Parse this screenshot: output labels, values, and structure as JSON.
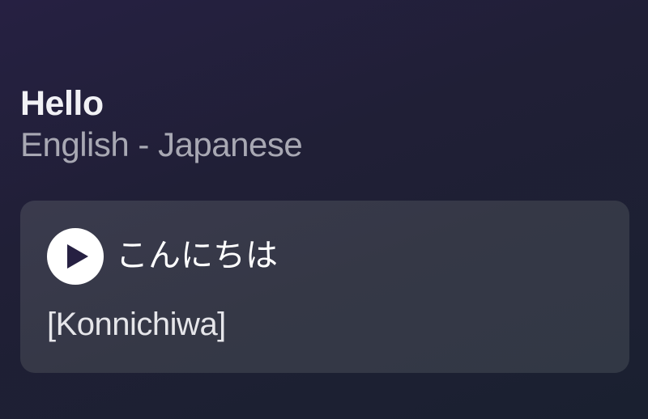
{
  "header": {
    "word": "Hello",
    "language_pair": "English - Japanese"
  },
  "card": {
    "play_icon": "play-icon",
    "translation": "こんにちは",
    "romanization": "[Konnichiwa]"
  },
  "colors": {
    "background_top": "#262042",
    "background_bottom": "#1a2030",
    "card_background": "#373a4a",
    "play_button_bg": "#ffffff",
    "play_icon_color": "#262042"
  }
}
